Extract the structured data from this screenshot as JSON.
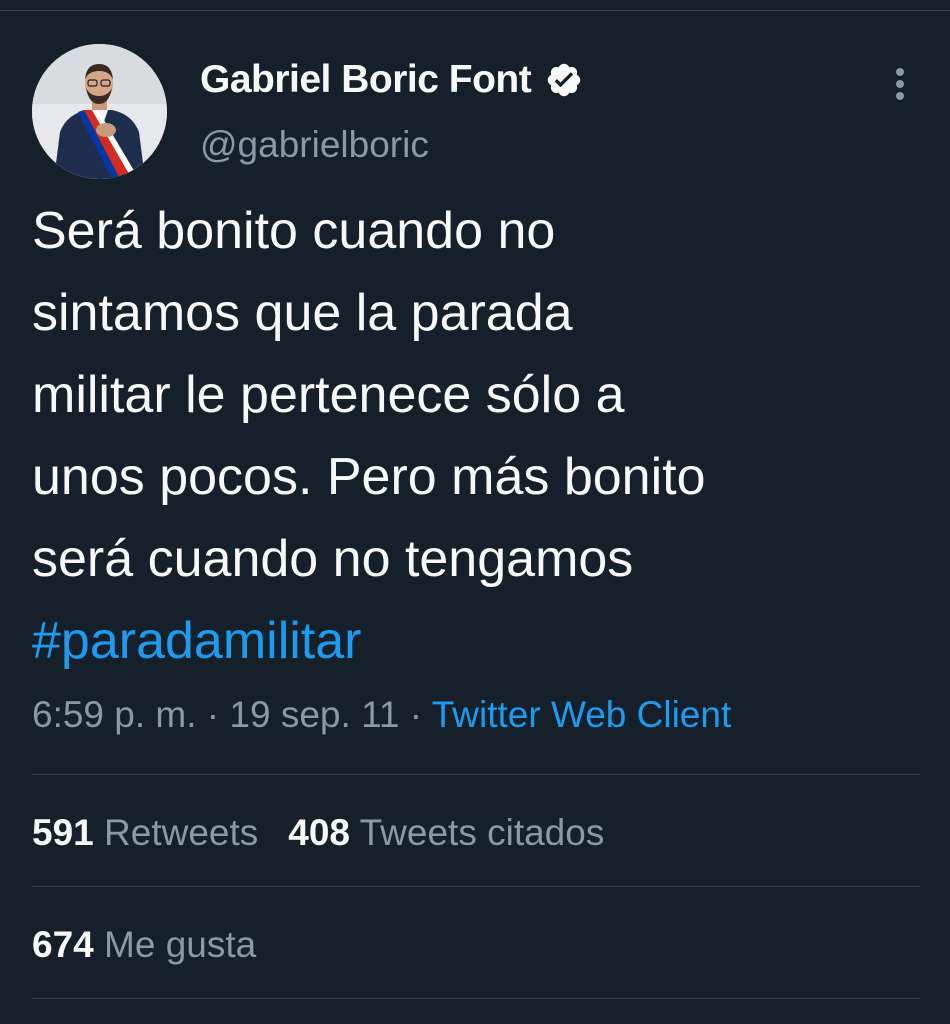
{
  "author": {
    "display_name": "Gabriel Boric Font",
    "handle": "@gabrielboric",
    "verified_icon": "verified-badge-icon",
    "avatar_icon": "profile-avatar"
  },
  "tweet": {
    "lines": [
      "Será bonito cuando no",
      "sintamos que la parada",
      "militar le pertenece sólo a",
      "unos pocos. Pero más bonito",
      "será cuando no tengamos"
    ],
    "hashtag": "#paradamilitar"
  },
  "meta": {
    "time": "6:59 p. m.",
    "sep1": " · ",
    "date": "19 sep. 11",
    "sep2": " · ",
    "source": "Twitter Web Client"
  },
  "stats": {
    "retweets": {
      "count": "591",
      "label": "Retweets"
    },
    "quotes": {
      "count": "408",
      "label": "Tweets citados"
    },
    "likes": {
      "count": "674",
      "label": "Me gusta"
    }
  },
  "colors": {
    "background": "#15202b",
    "text": "#f7f9f9",
    "secondary_text": "#8b98a5",
    "link": "#1d9bf0",
    "divider": "#38444d"
  },
  "icons": {
    "more": "more-vertical-icon"
  }
}
